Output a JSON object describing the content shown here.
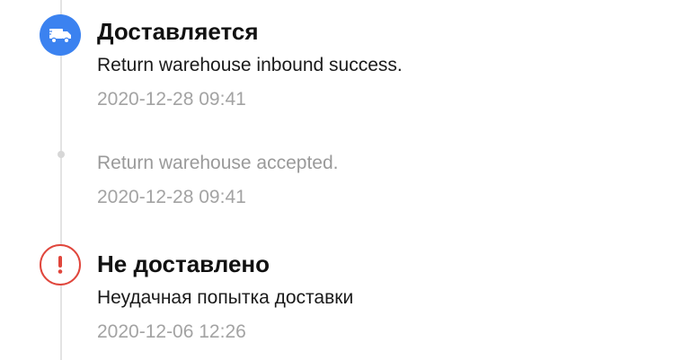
{
  "timeline": {
    "events": [
      {
        "status": "Доставляется",
        "icon": "truck-icon",
        "description": "Return warehouse inbound success.",
        "time": "2020-12-28 09:41"
      },
      {
        "status": "",
        "icon": "dot-icon",
        "description": "Return warehouse accepted.",
        "time": "2020-12-28 09:41"
      },
      {
        "status": "Не доставлено",
        "icon": "exclamation-icon",
        "description": "Неудачная попытка доставки",
        "time": "2020-12-06 12:26"
      }
    ]
  },
  "colors": {
    "accent_blue": "#3b82f0",
    "error_red": "#e0463c",
    "timeline_line": "#e3e3e3",
    "muted_text": "#a3a3a3"
  }
}
